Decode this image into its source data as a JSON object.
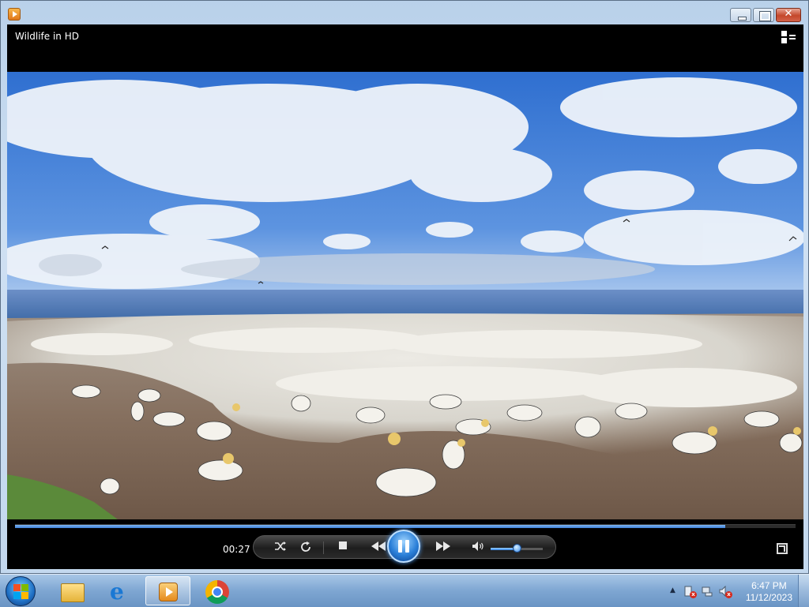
{
  "window": {
    "title": "Wildlife in HD",
    "close_glyph": "✕"
  },
  "player": {
    "elapsed_time": "00:27",
    "progress": 0.91,
    "volume": 0.5,
    "state": "playing",
    "controls": {
      "shuffle_icon": "shuffle-icon",
      "repeat_icon": "repeat-icon",
      "stop_icon": "stop-icon",
      "previous_icon": "rewind-icon",
      "play_pause_icon": "pause-icon",
      "next_icon": "fast-forward-icon",
      "mute_icon": "speaker-icon",
      "fullscreen_icon": "fullscreen-icon",
      "mode_switch_icon": "switch-to-library-icon"
    },
    "colors": {
      "seek_fill": "#3d7fd8",
      "play_button": "#2a7fd8"
    }
  },
  "taskbar": {
    "items": [
      {
        "name": "windows-explorer",
        "icon": "folder-icon"
      },
      {
        "name": "internet-explorer",
        "icon": "ie-icon"
      },
      {
        "name": "windows-media-player",
        "icon": "media-player-icon",
        "active": true
      },
      {
        "name": "google-chrome",
        "icon": "chrome-icon"
      }
    ],
    "tray": {
      "show_hidden_glyph": "▲",
      "icons": [
        "action-center-icon",
        "network-icon",
        "volume-icon"
      ],
      "time": "6:47 PM",
      "date": "11/12/2023"
    }
  }
}
